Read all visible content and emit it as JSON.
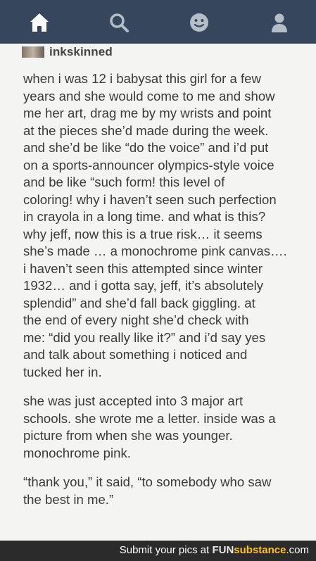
{
  "post": {
    "username": "inkskinned",
    "paragraphs": [
      [
        "when i was 12 i babysat this girl for a few",
        "years and she would come to me and show",
        "me her art, drag me by my wrists and point",
        "at the pieces she’d made during the week.",
        "and she’d be like “do the voice” and i’d put",
        "on a sports-announcer olympics-style voice",
        "and be like “such form! this level of",
        "coloring! why i haven’t seen such perfection",
        "in crayola in a long time. and what is this?",
        "why jeff, now this is a true risk… it seems",
        "she’s made … a monochrome pink canvas….",
        "i haven’t seen this attempted since winter",
        "1932… and i gotta say, jeff, it’s absolutely",
        "splendid”  and she’d fall back giggling. at",
        "the end of every night she’d check with",
        "me: “did you really like it?” and i’d say yes",
        "and talk about something i noticed and",
        "tucked her in."
      ],
      [
        "she was just accepted into 3 major art",
        "schools. she wrote me a letter. inside was a",
        "picture from when she was younger.",
        "monochrome pink."
      ],
      [
        "“thank you,” it said, “to somebody who saw",
        "the best in me.”"
      ]
    ]
  },
  "footer": {
    "submit_text": "Submit your pics at",
    "brand_part1": "FUN",
    "brand_part2": "substance",
    "brand_part3": ".com"
  },
  "colors": {
    "navbar": "#36465d",
    "icon_fill": "#b5bdc7",
    "home_icon": "#ffffff",
    "footer_bg": "#2b2b2b",
    "brand_accent": "#ffc21a"
  },
  "icons": {
    "nav": [
      "home-icon",
      "search-icon",
      "smiley-icon",
      "person-icon"
    ]
  }
}
